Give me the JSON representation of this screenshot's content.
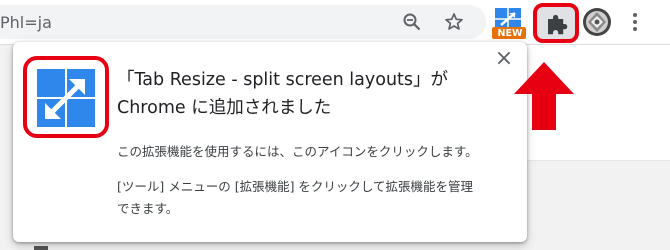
{
  "browser": {
    "url_fragment": "Phl=ja",
    "new_badge": "NEW"
  },
  "popup": {
    "title_line1": "「Tab Resize - split screen layouts」が",
    "title_line2": "Chrome に追加されました",
    "body_line1": "この拡張機能を使用するには、このアイコンをクリックします。",
    "body_line2": "[ツール] メニューの [拡張機能] をクリックして拡張機能を管理",
    "body_line3": "できます。",
    "close_label": "×"
  },
  "colors": {
    "annotation_red": "#e60012",
    "tab_resize_blue": "#2f86eb"
  },
  "icons": [
    "zoom-icon",
    "bookmark-star-icon",
    "tab-resize-extension-icon",
    "extensions-puzzle-icon",
    "profile-avatar-icon",
    "more-menu-icon",
    "close-icon",
    "red-pointer-arrow"
  ]
}
